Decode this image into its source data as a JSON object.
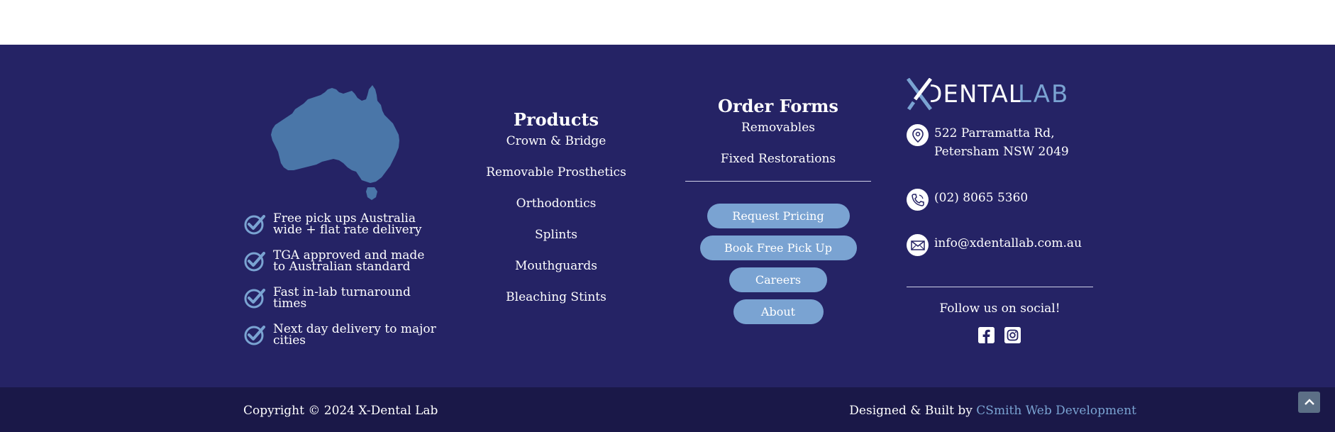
{
  "features": [
    {
      "line1": "Free pick ups Australia",
      "line2": "wide + flat rate delivery"
    },
    {
      "line1": "TGA approved and made",
      "line2": "to Australian standard"
    },
    {
      "line1": "Fast in-lab turnaround",
      "line2": "times"
    },
    {
      "line1": "Next day delivery to major",
      "line2": "cities"
    }
  ],
  "products": {
    "title": "Products",
    "links": [
      "Crown & Bridge",
      "Removable Prosthetics",
      "Orthodontics",
      "Splints",
      "Mouthguards",
      "Bleaching Stints"
    ]
  },
  "order_forms": {
    "title": "Order Forms",
    "links": [
      "Removables",
      "Fixed Restorations"
    ],
    "buttons": [
      "Request Pricing",
      "Book Free Pick Up",
      "Careers",
      "About"
    ]
  },
  "logo": {
    "part1": "XDENTAL",
    "part2": "LAB"
  },
  "contact": {
    "address_line1": "522 Parramatta Rd,",
    "address_line2": "Petersham NSW 2049",
    "phone": "(02) 8065 5360",
    "email": "info@xdentallab.com.au"
  },
  "social": {
    "heading": "Follow us on social!",
    "icons": [
      "facebook-icon",
      "instagram-icon"
    ]
  },
  "bottom": {
    "copyright": "Copyright © 2024 X-Dental Lab",
    "credits_prefix": "Designed & Built by ",
    "credits_link": "CSmith Web Development"
  },
  "colors": {
    "footer_bg": "#252365",
    "bottom_bar_bg": "#1a1848",
    "accent": "#7aa3d2",
    "map_fill": "#4a76a8",
    "scroll_top_bg": "#5c6f86"
  }
}
